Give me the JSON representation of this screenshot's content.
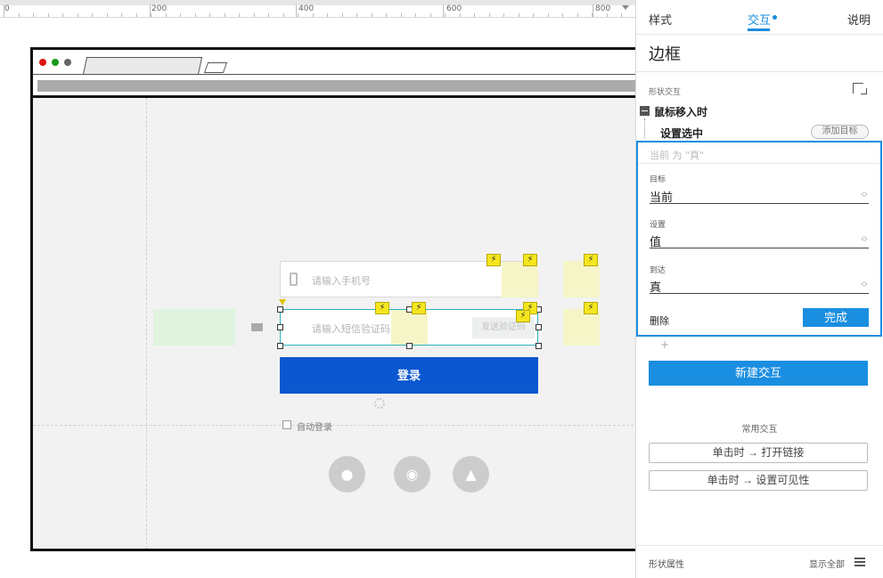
{
  "ruler": {
    "marks": [
      "0",
      "200",
      "400",
      "600",
      "800"
    ]
  },
  "prototype": {
    "phone_placeholder": "请输入手机号",
    "sms_placeholder": "请输入短信验证码",
    "send_code_label": "发送验证码",
    "login_label": "登录",
    "auto_login_label": "自动登录",
    "social_icons": [
      "wechat-icon",
      "weibo-icon",
      "qq-icon"
    ],
    "bolt_glyph": "⚡"
  },
  "panel": {
    "tabs": [
      "样式",
      "交互",
      "说明"
    ],
    "active_tab": "交互",
    "title": "边框",
    "shape_interaction_label": "形状交互",
    "event_label": "鼠标移入时",
    "action_label": "设置选中",
    "add_target_label": "添加目标",
    "editor": {
      "summary": "当前 为 \"真\"",
      "target_label": "目标",
      "target_value": "当前",
      "set_label": "设置",
      "set_value": "值",
      "to_label": "到达",
      "to_value": "真",
      "delete_label": "删除",
      "done_label": "完成"
    },
    "plus_label": "+",
    "new_interaction_label": "新建交互",
    "common_label": "常用交互",
    "quick_actions": [
      "单击时 → 打开链接",
      "单击时 → 设置可见性"
    ],
    "footer_left": "形状属性",
    "footer_right": "显示全部"
  },
  "colors": {
    "accent": "#1a8ee0",
    "login_button": "#0b57d0",
    "bolt": "#f4e61f"
  }
}
